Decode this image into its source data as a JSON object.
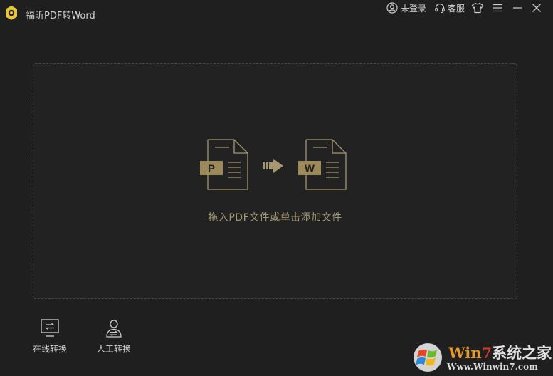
{
  "app": {
    "title": "福昕PDF转Word"
  },
  "titlebar": {
    "login_label": "未登录",
    "service_label": "客服",
    "icons": [
      "user-icon",
      "headset-icon",
      "shirt-icon",
      "menu-icon",
      "minimize-icon",
      "close-icon"
    ]
  },
  "drop_zone": {
    "hint": "拖入PDF文件或单击添加文件",
    "source_badge": "P",
    "target_badge": "W"
  },
  "tools": [
    {
      "label": "在线转换",
      "icon": "online-convert-icon"
    },
    {
      "label": "人工转换",
      "icon": "manual-convert-icon"
    }
  ],
  "watermark": {
    "brand_w": "W",
    "brand_in": "in",
    "brand_7": "7",
    "brand_rest": "系统之家",
    "url": "Www.Winwin7.com"
  },
  "colors": {
    "background": "#1f1f1f",
    "accent_gold": "#a69770",
    "badge_gold": "#9c8a5a"
  }
}
